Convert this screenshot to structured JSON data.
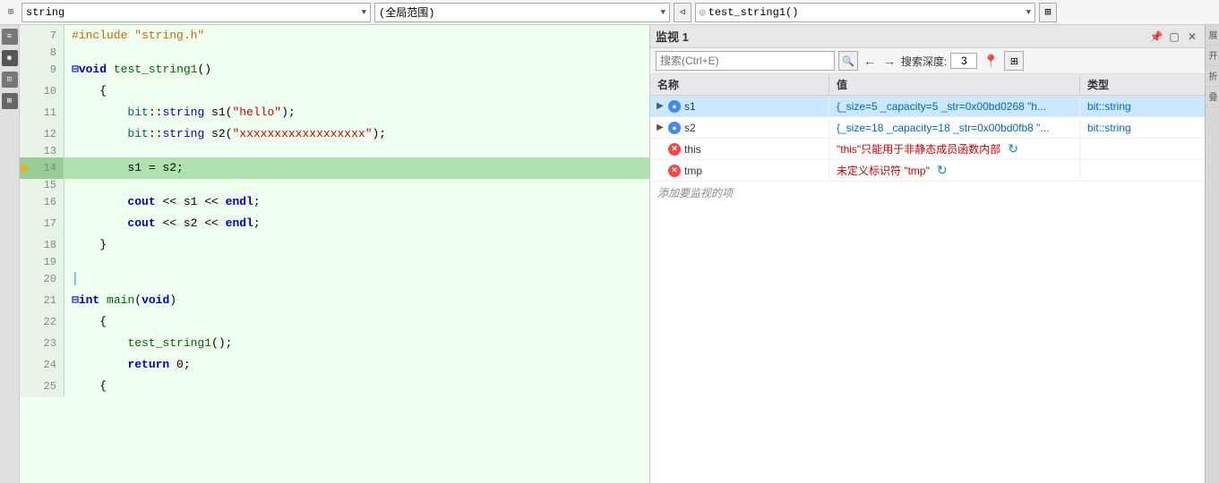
{
  "toolbar": {
    "dropdown1": "string",
    "dropdown2": "(全局范围)",
    "dropdown3": "test_string1()",
    "split_arrow": "⊞"
  },
  "sidebar_icons": [
    "≡",
    "◉",
    "⊡",
    "⊞"
  ],
  "code": {
    "lines": [
      {
        "num": 7,
        "content": "#include \"string.h\"",
        "tokens": [
          {
            "t": "inc",
            "v": "#include \"string.h\""
          }
        ],
        "type": "normal"
      },
      {
        "num": 8,
        "content": "",
        "tokens": [],
        "type": "normal"
      },
      {
        "num": 9,
        "content": "⊟void test_string1()",
        "tokens": [
          {
            "t": "collapse",
            "v": "⊟"
          },
          {
            "t": "kw",
            "v": "void"
          },
          {
            "t": "",
            "v": " "
          },
          {
            "t": "fn",
            "v": "test_string1"
          },
          {
            "t": "",
            "v": "()"
          }
        ],
        "type": "normal"
      },
      {
        "num": 10,
        "content": "    {",
        "tokens": [
          {
            "t": "",
            "v": "    {"
          }
        ],
        "type": "normal"
      },
      {
        "num": 11,
        "content": "        bit::string s1(\"hello\");",
        "tokens": [
          {
            "t": "ns",
            "v": "bit"
          },
          {
            "t": "",
            "v": "::"
          },
          {
            "t": "type",
            "v": "string"
          },
          {
            "t": "",
            "v": " "
          },
          {
            "t": "var",
            "v": "s1"
          },
          {
            "t": "",
            "v": "("
          },
          {
            "t": "str",
            "v": "\"hello\""
          },
          {
            "t": "",
            "v": ");"
          }
        ],
        "type": "normal"
      },
      {
        "num": 12,
        "content": "        bit::string s2(\"xxxxxxxxxxxxxxxxxx\");",
        "tokens": [
          {
            "t": "ns",
            "v": "bit"
          },
          {
            "t": "",
            "v": "::"
          },
          {
            "t": "type",
            "v": "string"
          },
          {
            "t": "",
            "v": " "
          },
          {
            "t": "var",
            "v": "s2"
          },
          {
            "t": "",
            "v": "("
          },
          {
            "t": "str",
            "v": "\"xxxxxxxxxxxxxxxxxx\""
          },
          {
            "t": "",
            "v": ");"
          }
        ],
        "type": "normal"
      },
      {
        "num": 13,
        "content": "",
        "tokens": [],
        "type": "normal"
      },
      {
        "num": 14,
        "content": "        s1 = s2;",
        "tokens": [
          {
            "t": "",
            "v": "        s1 = s2;"
          }
        ],
        "type": "current",
        "hasArrow": true
      },
      {
        "num": 15,
        "content": "",
        "tokens": [],
        "type": "normal"
      },
      {
        "num": 16,
        "content": "        cout << s1 << endl;",
        "tokens": [
          {
            "t": "",
            "v": "        "
          },
          {
            "t": "kw",
            "v": "cout"
          },
          {
            "t": "",
            "v": " << s1 << "
          },
          {
            "t": "kw",
            "v": "endl"
          },
          {
            "t": "",
            "v": ";"
          }
        ],
        "type": "normal"
      },
      {
        "num": 17,
        "content": "        cout << s2 << endl;",
        "tokens": [
          {
            "t": "",
            "v": "        "
          },
          {
            "t": "kw",
            "v": "cout"
          },
          {
            "t": "",
            "v": " << s2 << "
          },
          {
            "t": "kw",
            "v": "endl"
          },
          {
            "t": "",
            "v": ";"
          }
        ],
        "type": "normal"
      },
      {
        "num": 18,
        "content": "    }",
        "tokens": [
          {
            "t": "",
            "v": "    }"
          }
        ],
        "type": "normal"
      },
      {
        "num": 19,
        "content": "",
        "tokens": [],
        "type": "normal"
      },
      {
        "num": 20,
        "content": "│",
        "tokens": [
          {
            "t": "",
            "v": "│"
          }
        ],
        "type": "normal"
      },
      {
        "num": 21,
        "content": "⊟int main(void)",
        "tokens": [
          {
            "t": "collapse",
            "v": "⊟"
          },
          {
            "t": "kw",
            "v": "int"
          },
          {
            "t": "",
            "v": " "
          },
          {
            "t": "fn",
            "v": "main"
          },
          {
            "t": "",
            "v": "("
          },
          {
            "t": "kw",
            "v": "void"
          },
          {
            "t": "",
            "v": ")"
          }
        ],
        "type": "normal"
      },
      {
        "num": 22,
        "content": "    {",
        "tokens": [
          {
            "t": "",
            "v": "    {"
          }
        ],
        "type": "normal"
      },
      {
        "num": 23,
        "content": "        test_string1();",
        "tokens": [
          {
            "t": "",
            "v": "        "
          },
          {
            "t": "fn",
            "v": "test_string1"
          },
          {
            "t": "",
            "v": "();"
          }
        ],
        "type": "normal"
      },
      {
        "num": 24,
        "content": "        return 0;",
        "tokens": [
          {
            "t": "",
            "v": "        "
          },
          {
            "t": "kw",
            "v": "return"
          },
          {
            "t": "",
            "v": " 0;"
          }
        ],
        "type": "normal"
      },
      {
        "num": 25,
        "content": "    {",
        "tokens": [
          {
            "t": "",
            "v": "    {"
          }
        ],
        "type": "normal"
      }
    ]
  },
  "watch_panel": {
    "title": "监视 1",
    "search_placeholder": "搜索(Ctrl+E)",
    "depth_label": "搜索深度:",
    "depth_value": "3",
    "columns": [
      {
        "label": "名称"
      },
      {
        "label": "值"
      },
      {
        "label": "类型"
      }
    ],
    "rows": [
      {
        "name": "s1",
        "icon": "blue",
        "has_expand": true,
        "value": "{_size=5 _capacity=5 _str=0x00bd0268 \"h...",
        "type": "bit::string",
        "selected": true
      },
      {
        "name": "s2",
        "icon": "blue",
        "has_expand": true,
        "value": "{_size=18 _capacity=18 _str=0x00bd0fb8 \"...",
        "type": "bit::string",
        "selected": false
      },
      {
        "name": "this",
        "icon": "error",
        "has_expand": false,
        "value": "\"this\"只能用于非静态成员函数内部",
        "value_color": "red",
        "type": "",
        "has_refresh": true,
        "selected": false
      },
      {
        "name": "tmp",
        "icon": "error",
        "has_expand": false,
        "value": "未定义标识符 \"tmp\"",
        "value_color": "red",
        "type": "",
        "has_refresh": true,
        "selected": false
      }
    ],
    "add_watch_text": "添加要监视的项"
  },
  "right_bar": {
    "items": [
      "展",
      "开",
      "折",
      "叠"
    ]
  }
}
